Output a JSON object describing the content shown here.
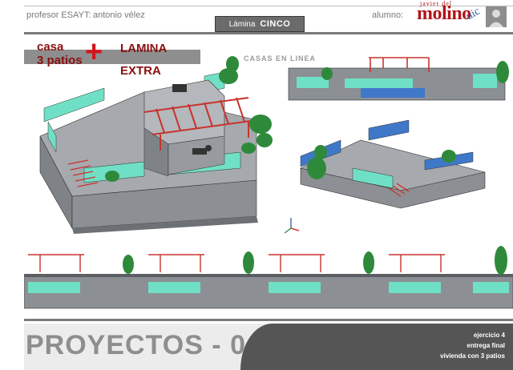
{
  "header": {
    "professor_label": "profesor ESAYT:",
    "professor_name": "antonio vélez",
    "sheet_tab_label": "Lámina",
    "sheet_tab_value": "CINCO",
    "student_label": "alumno:",
    "logo": {
      "top_text": "javier del",
      "main_text": "molino",
      "side_text": "uic"
    }
  },
  "sheet": {
    "title_line1": "casa",
    "title_line2": "3 patios",
    "plus_symbol": "+",
    "extra_line1": "LAMINA",
    "extra_line2": "EXTRA",
    "subtitle": "CASAS EN LINEA"
  },
  "footer": {
    "title": "PROYECTOS - 0",
    "info_line1": "ejercicio 4",
    "info_line2": "entrega final",
    "info_line3": "vivienda con 3 patios"
  },
  "colors": {
    "wall_grey": "#8c8f93",
    "cyan": "#6fe0c6",
    "blue": "#3f78c8",
    "pergola_red": "#c8332e",
    "plant_green": "#2e8a3a",
    "logo_red": "#b0151b"
  }
}
